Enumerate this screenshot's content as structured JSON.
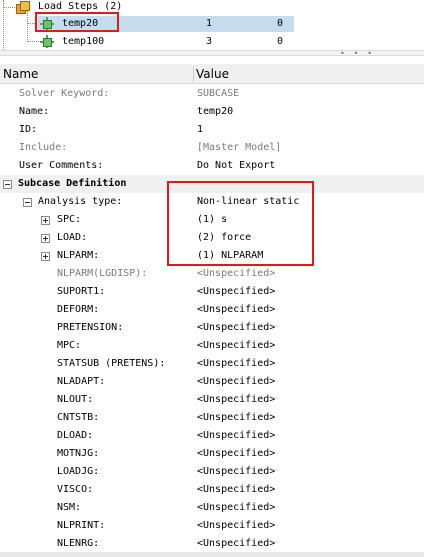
{
  "tree": {
    "root_label": "Load Steps (2)",
    "items": [
      {
        "name": "temp20",
        "col1": "1",
        "col2": "0"
      },
      {
        "name": "temp100",
        "col1": "3",
        "col2": "0"
      }
    ]
  },
  "splitter": {
    "grip": "• • •"
  },
  "headers": {
    "name": "Name",
    "value": "Value"
  },
  "props": [
    {
      "label": "Solver Keyword:",
      "value": "SUBCASE"
    },
    {
      "label": "Name:",
      "value": "temp20"
    },
    {
      "label": "ID:",
      "value": "1"
    },
    {
      "label": "Include:",
      "value": "[Master Model]"
    },
    {
      "label": "User Comments:",
      "value": "Do Not Export"
    }
  ],
  "section": {
    "label": "Subcase Definition"
  },
  "analysis": {
    "label": "Analysis type:",
    "value": "Non-linear static"
  },
  "sub_props": [
    {
      "label": "SPC:",
      "value": "(1) s"
    },
    {
      "label": "LOAD:",
      "value": "(2) force"
    },
    {
      "label": "NLPARM:",
      "value": "(1) NLPARAM"
    },
    {
      "label": "NLPARM(LGDISP):",
      "value": "<Unspecified>"
    },
    {
      "label": "SUPORT1:",
      "value": "<Unspecified>"
    },
    {
      "label": "DEFORM:",
      "value": "<Unspecified>"
    },
    {
      "label": "PRETENSION:",
      "value": "<Unspecified>"
    },
    {
      "label": "MPC:",
      "value": "<Unspecified>"
    },
    {
      "label": "STATSUB (PRETENS):",
      "value": "<Unspecified>"
    },
    {
      "label": "NLADAPT:",
      "value": "<Unspecified>"
    },
    {
      "label": "NLOUT:",
      "value": "<Unspecified>"
    },
    {
      "label": "CNTSTB:",
      "value": "<Unspecified>"
    },
    {
      "label": "DLOAD:",
      "value": "<Unspecified>"
    },
    {
      "label": "MOTNJG:",
      "value": "<Unspecified>"
    },
    {
      "label": "LOADJG:",
      "value": "<Unspecified>"
    },
    {
      "label": "VISCO:",
      "value": "<Unspecified>"
    },
    {
      "label": "NSM:",
      "value": "<Unspecified>"
    },
    {
      "label": "NLPRINT:",
      "value": "<Unspecified>"
    },
    {
      "label": "NLENRG:",
      "value": "<Unspecified>"
    }
  ],
  "colors": {
    "selection": "#c5dcee",
    "highlight_box": "#e01919",
    "section_bg": "#f0f0f0"
  }
}
